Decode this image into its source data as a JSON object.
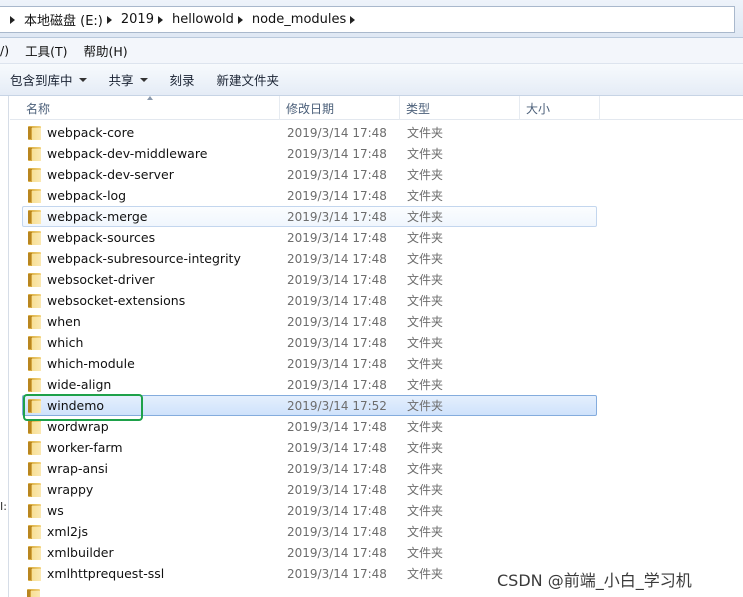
{
  "address": {
    "crumbs": [
      "本地磁盘 (E:)",
      "2019",
      "hellowold",
      "node_modules"
    ]
  },
  "menu": {
    "items": [
      "/)",
      "工具(T)",
      "帮助(H)"
    ]
  },
  "toolbar": {
    "include_label": "包含到库中",
    "share_label": "共享",
    "burn_label": "刻录",
    "new_folder_label": "新建文件夹"
  },
  "navpane": {
    "fragment": "I:"
  },
  "columns": {
    "name": "名称",
    "date": "修改日期",
    "type": "类型",
    "size": "大小"
  },
  "rows": [
    {
      "name": "webpack-core",
      "date": "2019/3/14 17:48",
      "type": "文件夹"
    },
    {
      "name": "webpack-dev-middleware",
      "date": "2019/3/14 17:48",
      "type": "文件夹"
    },
    {
      "name": "webpack-dev-server",
      "date": "2019/3/14 17:48",
      "type": "文件夹"
    },
    {
      "name": "webpack-log",
      "date": "2019/3/14 17:48",
      "type": "文件夹"
    },
    {
      "name": "webpack-merge",
      "date": "2019/3/14 17:48",
      "type": "文件夹",
      "state": "hover"
    },
    {
      "name": "webpack-sources",
      "date": "2019/3/14 17:48",
      "type": "文件夹"
    },
    {
      "name": "webpack-subresource-integrity",
      "date": "2019/3/14 17:48",
      "type": "文件夹"
    },
    {
      "name": "websocket-driver",
      "date": "2019/3/14 17:48",
      "type": "文件夹"
    },
    {
      "name": "websocket-extensions",
      "date": "2019/3/14 17:48",
      "type": "文件夹"
    },
    {
      "name": "when",
      "date": "2019/3/14 17:48",
      "type": "文件夹"
    },
    {
      "name": "which",
      "date": "2019/3/14 17:48",
      "type": "文件夹"
    },
    {
      "name": "which-module",
      "date": "2019/3/14 17:48",
      "type": "文件夹"
    },
    {
      "name": "wide-align",
      "date": "2019/3/14 17:48",
      "type": "文件夹"
    },
    {
      "name": "windemo",
      "date": "2019/3/14 17:52",
      "type": "文件夹",
      "state": "selected"
    },
    {
      "name": "wordwrap",
      "date": "2019/3/14 17:48",
      "type": "文件夹"
    },
    {
      "name": "worker-farm",
      "date": "2019/3/14 17:48",
      "type": "文件夹"
    },
    {
      "name": "wrap-ansi",
      "date": "2019/3/14 17:48",
      "type": "文件夹"
    },
    {
      "name": "wrappy",
      "date": "2019/3/14 17:48",
      "type": "文件夹"
    },
    {
      "name": "ws",
      "date": "2019/3/14 17:48",
      "type": "文件夹"
    },
    {
      "name": "xml2js",
      "date": "2019/3/14 17:48",
      "type": "文件夹"
    },
    {
      "name": "xmlbuilder",
      "date": "2019/3/14 17:48",
      "type": "文件夹"
    },
    {
      "name": "xmlhttprequest-ssl",
      "date": "2019/3/14 17:48",
      "type": "文件夹"
    }
  ],
  "watermark": "CSDN @前端_小白_学习机",
  "colors": {
    "highlight_box": "#1ea14a",
    "selected_border": "#84acdd",
    "folder": "#f3d37d"
  }
}
